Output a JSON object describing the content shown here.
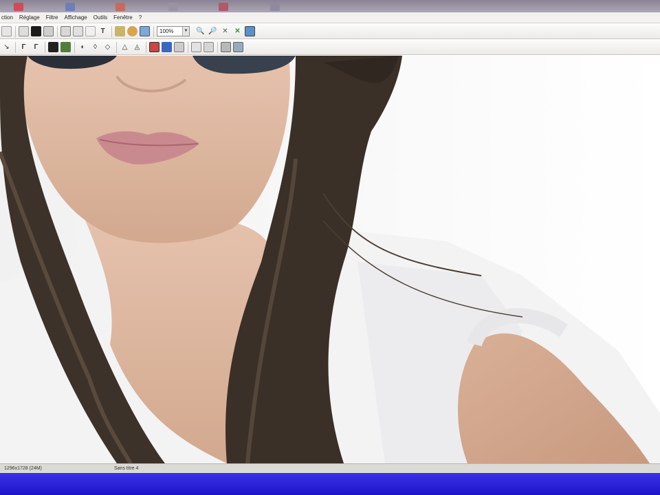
{
  "menubar": {
    "items": [
      "ction",
      "Réglage",
      "Filtre",
      "Affichage",
      "Outils",
      "Fenêtre",
      "?"
    ]
  },
  "toolbar": {
    "zoom_value": "100%",
    "text_tool_label": "T"
  },
  "statusbar": {
    "dimensions": "1296x1728 (24M)",
    "document_name": "Sans titre 4"
  },
  "colors": {
    "taskbar": "#2b22dd",
    "skin": "#d9b39a",
    "shirt": "#f2f2f2",
    "hair": "#3a3028"
  }
}
